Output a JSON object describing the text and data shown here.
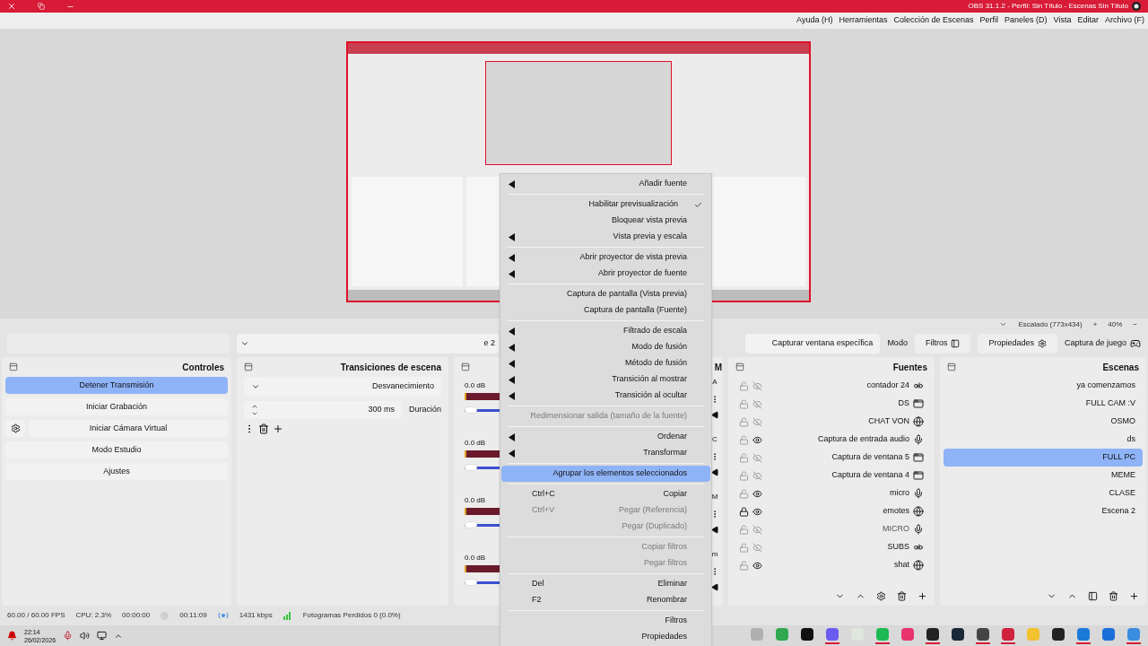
{
  "window": {
    "title": "OBS 31.1.2 - Perfil: Sin Título - Escenas Sin Título"
  },
  "menu_bar": [
    "Ayuda (H)",
    "Herramientas",
    "Colección de Escenas",
    "Perfil",
    "Paneles (D)",
    "Vista",
    "Editar",
    "Archivo (F)"
  ],
  "preview_status": {
    "zoom_minus": "−",
    "zoom": "40%",
    "zoom_plus": "+",
    "scaling": "Escalado (773x434)"
  },
  "source_toolbar": {
    "source": "Captura de juego",
    "properties": "Propiedades",
    "filters": "Filtros",
    "mode_label": "Modo",
    "mode_value": "Capturar ventana específica",
    "window_value": "e 2"
  },
  "scenes": {
    "title": "Escenas",
    "items": [
      {
        "label": "ya comenzamos",
        "selected": false
      },
      {
        "label": "FULL CAM :V",
        "selected": false
      },
      {
        "label": "OSMO",
        "selected": false
      },
      {
        "label": "ds",
        "selected": false
      },
      {
        "label": "FULL PC",
        "selected": true
      },
      {
        "label": "MEME",
        "selected": false
      },
      {
        "label": "CLASE",
        "selected": false
      },
      {
        "label": "Escena 2",
        "selected": false
      }
    ]
  },
  "sources": {
    "title": "Fuentes",
    "items": [
      {
        "label": "contador 24",
        "kind": "text",
        "visible": false,
        "locked": false
      },
      {
        "label": "DS",
        "kind": "window",
        "visible": false,
        "locked": false
      },
      {
        "label": "CHAT VON",
        "kind": "browser",
        "visible": false,
        "locked": false
      },
      {
        "label": "Captura de entrada audio",
        "kind": "audio",
        "visible": true,
        "locked": false
      },
      {
        "label": "Captura de ventana 5",
        "kind": "window",
        "visible": false,
        "locked": false
      },
      {
        "label": "Captura de ventana 4",
        "kind": "window",
        "visible": false,
        "locked": false
      },
      {
        "label": "micro",
        "kind": "audio",
        "visible": true,
        "locked": false
      },
      {
        "label": "emotes",
        "kind": "browser",
        "visible": true,
        "locked": true
      },
      {
        "label": "MICRO",
        "kind": "audio",
        "visible": false,
        "locked": false
      },
      {
        "label": "SUBS",
        "kind": "text",
        "visible": false,
        "locked": false
      },
      {
        "label": "shat",
        "kind": "browser",
        "visible": true,
        "locked": false
      }
    ]
  },
  "mixer": {
    "title": "M",
    "channels": [
      {
        "name": "A",
        "reading": "0.0 dB",
        "level": 1
      },
      {
        "name": "C",
        "reading": "0.0 dB",
        "level": 1
      },
      {
        "name": "M",
        "reading": "0.0 dB",
        "level": 1
      },
      {
        "name": "m",
        "reading": "0.0 dB",
        "level": 1
      }
    ]
  },
  "transitions": {
    "title": "Transiciones de escena",
    "type": "Desvanecimiento",
    "duration_label": "Duración",
    "duration": "300 ms"
  },
  "controls": {
    "title": "Controles",
    "buttons": [
      {
        "label": "Detener Transmisión",
        "active": true,
        "kind": "plain"
      },
      {
        "label": "Iniciar Grabación",
        "active": false,
        "kind": "plain"
      },
      {
        "label": "Iniciar Cámara Virtual",
        "active": false,
        "kind": "settings"
      },
      {
        "label": "Modo Estudio",
        "active": false,
        "kind": "plain"
      },
      {
        "label": "Ajustes",
        "active": false,
        "kind": "plain"
      }
    ]
  },
  "context_menu": [
    {
      "kind": "submenu",
      "label": "Añadir fuente",
      "disabled": false,
      "selected": false
    },
    {
      "kind": "separator"
    },
    {
      "kind": "check",
      "label": "Habilitar previsualización",
      "checked": true,
      "disabled": false,
      "selected": false
    },
    {
      "kind": "item",
      "label": "Bloquear vista previa",
      "disabled": false,
      "selected": false
    },
    {
      "kind": "submenu",
      "label": "Vista previa y escala",
      "disabled": false,
      "selected": false
    },
    {
      "kind": "separator"
    },
    {
      "kind": "submenu",
      "label": "Abrir proyector de vista previa",
      "disabled": false,
      "selected": false
    },
    {
      "kind": "submenu",
      "label": "Abrir proyector de fuente",
      "disabled": false,
      "selected": false
    },
    {
      "kind": "separator"
    },
    {
      "kind": "item",
      "label": "Captura de pantalla (Vista previa)",
      "disabled": false,
      "selected": false
    },
    {
      "kind": "item",
      "label": "Captura de pantalla (Fuente)",
      "disabled": false,
      "selected": false
    },
    {
      "kind": "separator"
    },
    {
      "kind": "submenu",
      "label": "Filtrado de escala",
      "disabled": false,
      "selected": false
    },
    {
      "kind": "submenu",
      "label": "Modo de fusión",
      "disabled": false,
      "selected": false
    },
    {
      "kind": "submenu",
      "label": "Método de fusión",
      "disabled": false,
      "selected": false
    },
    {
      "kind": "submenu",
      "label": "Transición al mostrar",
      "disabled": false,
      "selected": false
    },
    {
      "kind": "submenu",
      "label": "Transición al ocultar",
      "disabled": false,
      "selected": false
    },
    {
      "kind": "separator"
    },
    {
      "kind": "item",
      "label": "Redimensionar salida (tamaño de la fuente)",
      "disabled": true,
      "selected": false
    },
    {
      "kind": "separator"
    },
    {
      "kind": "submenu",
      "label": "Ordenar",
      "disabled": false,
      "selected": false
    },
    {
      "kind": "submenu",
      "label": "Transformar",
      "disabled": false,
      "selected": false
    },
    {
      "kind": "separator"
    },
    {
      "kind": "item",
      "label": "Agrupar los elementos seleccionados",
      "disabled": false,
      "selected": true
    },
    {
      "kind": "separator"
    },
    {
      "kind": "item",
      "label": "Copiar",
      "shortcut": "Ctrl+C",
      "disabled": false,
      "selected": false
    },
    {
      "kind": "item",
      "label": "Pegar (Referencia)",
      "shortcut": "Ctrl+V",
      "disabled": true,
      "selected": false
    },
    {
      "kind": "item",
      "label": "Pegar (Duplicado)",
      "disabled": true,
      "selected": false
    },
    {
      "kind": "separator"
    },
    {
      "kind": "item",
      "label": "Copiar filtros",
      "disabled": true,
      "selected": false
    },
    {
      "kind": "item",
      "label": "Pegar filtros",
      "disabled": true,
      "selected": false
    },
    {
      "kind": "separator"
    },
    {
      "kind": "item",
      "label": "Eliminar",
      "shortcut": "Del",
      "disabled": false,
      "selected": false
    },
    {
      "kind": "item",
      "label": "Renombrar",
      "shortcut": "F2",
      "disabled": false,
      "selected": false
    },
    {
      "kind": "separator"
    },
    {
      "kind": "item",
      "label": "Filtros",
      "disabled": false,
      "selected": false
    },
    {
      "kind": "item",
      "label": "Propiedades",
      "disabled": false,
      "selected": false
    }
  ],
  "status_bar": {
    "dropped": "Fotogramas Perdidos 0 (0.0%)",
    "bitrate": "1431 kbps",
    "stream_time": "00:11:09",
    "record_time": "00:00:00",
    "cpu": "CPU: 2.3%",
    "fps": "60.00 / 60.00 FPS"
  },
  "taskbar": {
    "time": "22:14",
    "date": "26/02/2026",
    "apps": [
      {
        "running": false
      },
      {
        "running": false
      },
      {
        "running": false
      },
      {
        "running": true
      },
      {
        "running": false
      },
      {
        "running": true
      },
      {
        "running": false
      },
      {
        "running": true
      },
      {
        "running": false
      },
      {
        "running": true
      },
      {
        "running": true
      },
      {
        "running": false
      },
      {
        "running": false
      },
      {
        "running": true
      },
      {
        "running": false
      },
      {
        "running": true
      }
    ]
  }
}
